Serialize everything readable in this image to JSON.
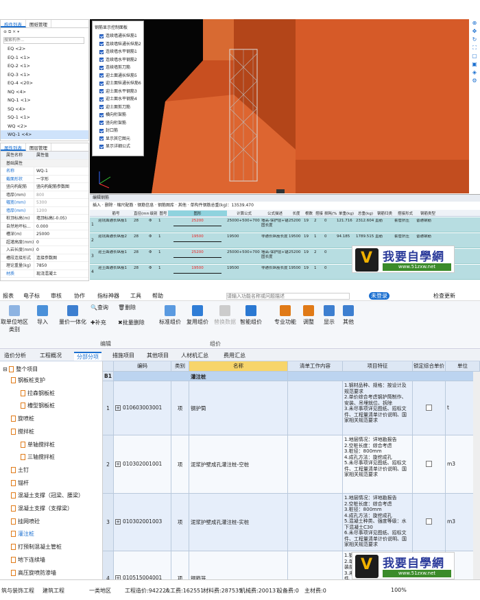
{
  "top": {
    "tabs": [
      "构件列表",
      "图纸管理"
    ],
    "search_placeholder": "搜索构件...",
    "components": [
      "EQ <2>",
      "EQ-1 <1>",
      "EQ-2 <1>",
      "EQ-3 <1>",
      "EQ-4 <20>",
      "NQ <4>",
      "NQ-1 <1>",
      "SQ <4>",
      "SQ-1 <1>",
      "WQ <2>",
      "WQ-1 <4>"
    ],
    "prop_tabs": [
      "属性列表",
      "图层管理"
    ],
    "prop_header": [
      "属性名称",
      "属性值"
    ],
    "prop_group": "基础属性",
    "props": [
      [
        "名称",
        "WQ-1"
      ],
      [
        "截面形状",
        "一字形"
      ],
      [
        "竖向构配筋",
        "竖向构配筋参数图"
      ],
      [
        "墙厚(mm)",
        "800"
      ],
      [
        "幅宽(mm)",
        "5300"
      ],
      [
        "墙厚(mm)",
        "1200"
      ],
      [
        "桩顶标高(m)",
        "墙顶标高(-0.05)"
      ],
      [
        "自然地坪标...",
        "0.000"
      ],
      [
        "槽深(m)",
        "25000"
      ],
      [
        "超灌高度(mm)",
        "0"
      ],
      [
        "入岩长度(mm)",
        "0"
      ],
      [
        "槽段连接形式",
        "连接参数图"
      ],
      [
        "理论重量(kg)",
        "7850"
      ],
      [
        "材质",
        "现浇混凝土"
      ]
    ],
    "control_panel": {
      "title": "钢筋显示控制面板",
      "items": [
        "连续墙通长纵筋1",
        "连续墙纵通长纵筋2",
        "连续墙水平钢筋1",
        "连续墙水平钢筋2",
        "连续墙剪刀筋",
        "迎土面通长纵筋5",
        "迎土面纵通长纵筋6",
        "迎土面水平钢筋3",
        "迎土面水平钢筋4",
        "迎土面剪刀筋",
        "横向桁架筋",
        "竖向桁架筋",
        "封口筋",
        "显示其它图元",
        "显示详细公式"
      ]
    },
    "rebar_editor": {
      "title": "编辑钢筋",
      "toolbar": [
        "插入",
        "删除",
        "缩尺配筋",
        "钢筋信息",
        "钢筋图库",
        "其他",
        "单构件钢筋总重(kg)：13539.470"
      ],
      "headers": [
        "筋号",
        "直径(mm)",
        "级别",
        "图号",
        "图形",
        "计算公式",
        "公式描述",
        "长度",
        "根数",
        "搭接",
        "损耗(%)",
        "单重(kg)",
        "总重(kg)",
        "钢筋归类",
        "搭接形式",
        "钢筋类型"
      ],
      "rows": [
        [
          "迎坑面通长纵筋1",
          "28",
          "Φ",
          "1",
          "25200",
          "25000+500+700",
          "墙高-保护层+锚固长度",
          "25200",
          "19",
          "2",
          "0",
          "121.716",
          "2312.604",
          "直筋",
          "套管挤压",
          "普通钢筋"
        ],
        [
          "迎坑面通长纵筋2",
          "28",
          "Φ",
          "1",
          "19500",
          "19500",
          "非通长纵筋长度",
          "19500",
          "19",
          "1",
          "0",
          "94.185",
          "1789.515",
          "直筋",
          "套管挤压",
          "普通钢筋"
        ],
        [
          "迎土面通长纵筋1",
          "28",
          "Φ",
          "1",
          "25200",
          "25000+500+700",
          "墙高-保护层+锚固长度",
          "25200",
          "19",
          "2",
          "0",
          "",
          "",
          "直筋",
          "套管挤压",
          "普通钢筋"
        ],
        [
          "迎土面通长纵筋1",
          "28",
          "Φ",
          "1",
          "19500",
          "19500",
          "非通长纵筋长度",
          "19500",
          "19",
          "1",
          "0",
          "",
          "",
          "直筋",
          "套管挤压",
          "普通钢筋"
        ]
      ]
    }
  },
  "watermark": {
    "name": "我要自學網",
    "url": "www.51zxw.net"
  },
  "bot": {
    "menu": [
      "报表",
      "电子标",
      "审核",
      "协作",
      "指标神器",
      "工具",
      "帮助"
    ],
    "search_placeholder": "请输入功能名称或问题描述",
    "menu_right": [
      "未登录",
      "检查更新"
    ],
    "left_btn": "取单位地区类别",
    "ribbon": [
      "导入",
      "量价一体化",
      "查询",
      "补充",
      "删除",
      "批量删除",
      "标准组价",
      "复用组价",
      "替换数据",
      "智能组价",
      "专业功能",
      "调整",
      "显示",
      "其他"
    ],
    "groups": [
      "编辑",
      "组价"
    ],
    "tabs": [
      "造价分析",
      "工程概况",
      "分部分项",
      "措施项目",
      "其他项目",
      "人材机汇总",
      "费用汇总"
    ],
    "tree": {
      "root": "整个项目",
      "items": [
        "钢板桩支护",
        "拉森钢板桩",
        "槽型钢板桩",
        "旋喷桩",
        "搅拌桩",
        "单轴搅拌桩",
        "三轴搅拌桩",
        "土钉",
        "锚杆",
        "混凝土支撑（冠梁、腰梁）",
        "混凝土支撑（支撑梁）",
        "挂网喷砼",
        "灌注桩",
        "打预制混凝土管桩",
        "地下连续墙",
        "高压旋喷防渗墙",
        "集水明排"
      ]
    },
    "grid_headers": [
      "编码",
      "类别",
      "名称",
      "清单工作内容",
      "项目特征",
      "锁定综合单价",
      "单位"
    ],
    "b1": {
      "tag": "B1",
      "name": "灌注桩"
    },
    "rows": [
      {
        "no": "1",
        "code": "010603003001",
        "type": "项",
        "name": "钢护筒",
        "feature": "1.钢材品种、规格：按设计及规范要求\n2.单价综合考虑钢护筒制作、安装、吊埋就位、拆除\n3.未尽事项详见图纸、招标文件、工程量清单计价说明、国家相关规范要求",
        "unit": "t"
      },
      {
        "no": "2",
        "code": "010302001001",
        "type": "项",
        "name": "泥浆护壁成孔灌注桩-空桩",
        "feature": "1.地层情况：详地勘报告\n2.空桩长度：综合考虑\n3.桩径：800mm\n4.成孔方法：旋挖成孔\n5.未尽事项详见图纸、招标文件、工程量清单计价说明、国家相关规范要求",
        "unit": "m3"
      },
      {
        "no": "3",
        "code": "010302001003",
        "type": "项",
        "name": "泥浆护壁成孔灌注桩-实桩",
        "feature": "1.地层情况：详地勘报告\n2.空桩长度：综合考虑\n3.桩径：800mm\n4.成孔方法：旋挖成孔\n5.混凝土种类、强度等级：水下混凝土C30\n6.未尽事项详见图纸、招标文件、工程量清单计价说明、国家相关规范要求",
        "unit": "m3"
      },
      {
        "no": "4",
        "code": "010515004001",
        "type": "项",
        "name": "钢筋笼",
        "feature": "1.钢筋种类、规格：综合考虑\n2.单价综合考虑连接方式、安装部位\n3.未尽事项详见图纸、招标文件、工程量清单计价说明、国家相关规范要求",
        "unit": "t"
      }
    ],
    "status": [
      "筑与装饰工程",
      "建筑工程",
      "一类地区",
      "工程造价:942220",
      "人工费:162551",
      "材料费:287535",
      "机械费:200137",
      "设备费:0",
      "主材费:0",
      "100%"
    ]
  },
  "colors": {
    "accent": "#1a6fd0",
    "wall": "#d65a28",
    "wall_dark": "#b6461c",
    "row_teal": "#b7dde1"
  }
}
